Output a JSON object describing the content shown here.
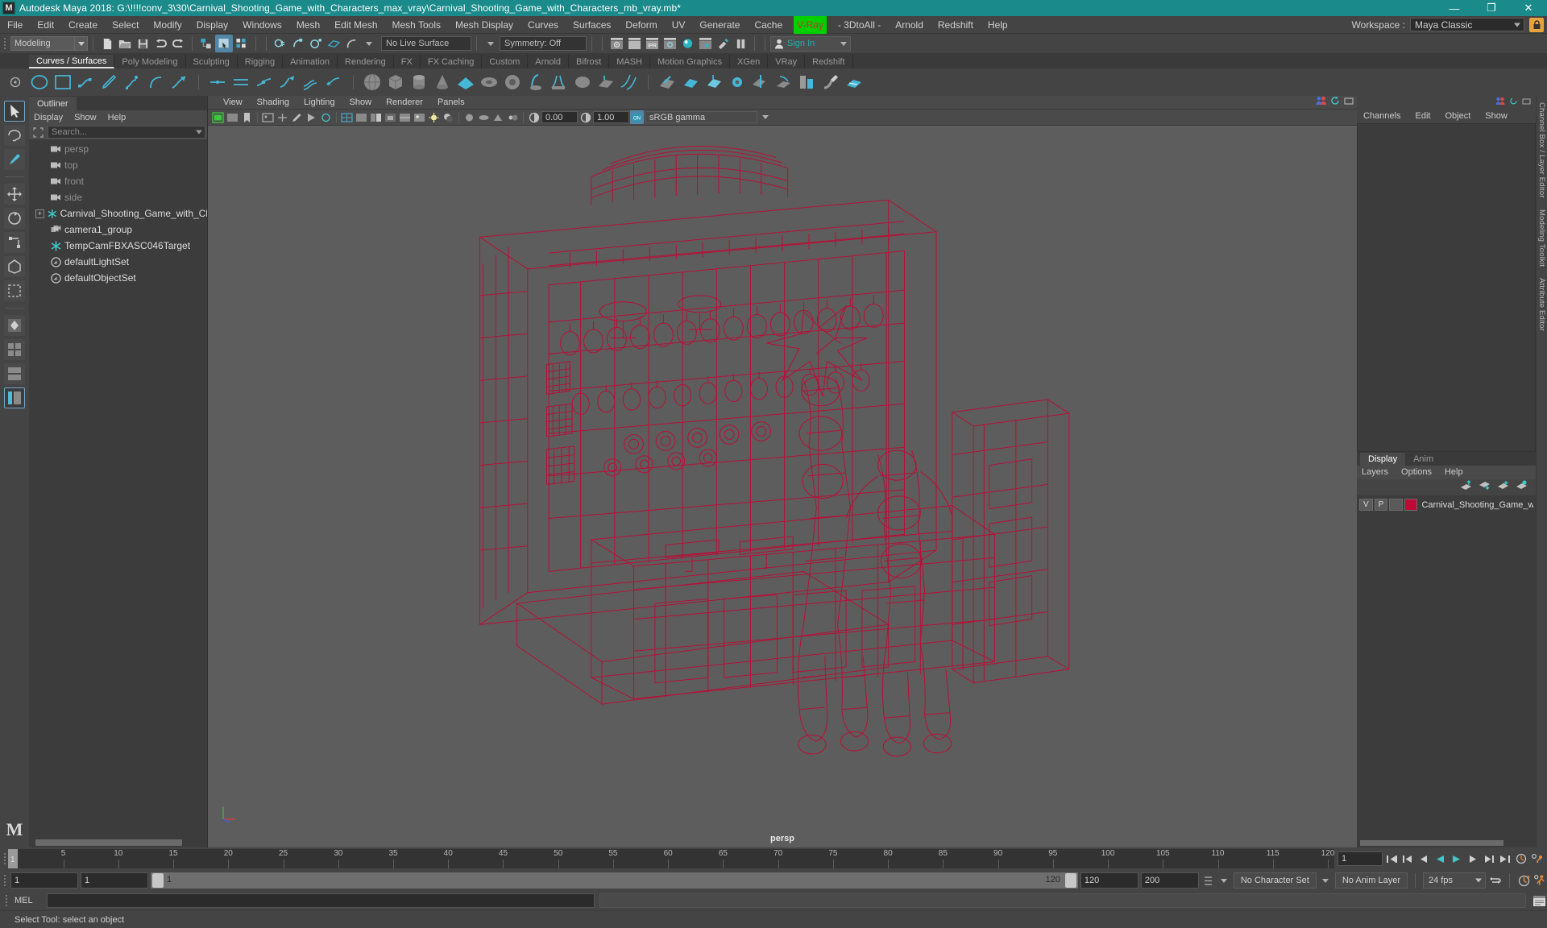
{
  "titlebar": {
    "app_title": "Autodesk Maya 2018: G:\\!!!!conv_3\\30\\Carnival_Shooting_Game_with_Characters_max_vray\\Carnival_Shooting_Game_with_Characters_mb_vray.mb*",
    "logo_text": "M",
    "minimize": "—",
    "maximize": "❐",
    "close": "✕",
    "accent_color": "#1a8a8a"
  },
  "menubar": {
    "items": [
      "File",
      "Edit",
      "Create",
      "Select",
      "Modify",
      "Display",
      "Windows",
      "Mesh",
      "Edit Mesh",
      "Mesh Tools",
      "Mesh Display",
      "Curves",
      "Surfaces",
      "Deform",
      "UV",
      "Generate",
      "Cache"
    ],
    "vray_item": "V-Ray",
    "vray_bg_color": "#00d000",
    "vray_text_color": "#c83232",
    "after_vray": [
      "- 3DtoAll -",
      "Arnold",
      "Redshift",
      "Help"
    ],
    "workspace_label": "Workspace :",
    "workspace_value": "Maya Classic"
  },
  "statusline": {
    "mode_value": "Modeling",
    "live_surface": "No Live Surface",
    "symmetry": "Symmetry: Off",
    "signin": "Sign In",
    "ipr_label": "IPR"
  },
  "shelf": {
    "tabs": [
      {
        "label": "Curves / Surfaces",
        "active": true
      },
      {
        "label": "Poly Modeling",
        "active": false
      },
      {
        "label": "Sculpting",
        "active": false
      },
      {
        "label": "Rigging",
        "active": false
      },
      {
        "label": "Animation",
        "active": false
      },
      {
        "label": "Rendering",
        "active": false
      },
      {
        "label": "FX",
        "active": false
      },
      {
        "label": "FX Caching",
        "active": false
      },
      {
        "label": "Custom",
        "active": false
      },
      {
        "label": "Arnold",
        "active": false
      },
      {
        "label": "Bifrost",
        "active": false
      },
      {
        "label": "MASH",
        "active": false
      },
      {
        "label": "Motion Graphics",
        "active": false
      },
      {
        "label": "XGen",
        "active": false
      },
      {
        "label": "VRay",
        "active": false
      },
      {
        "label": "Redshift",
        "active": false
      }
    ]
  },
  "outliner": {
    "tab_label": "Outliner",
    "menus": [
      "Display",
      "Show",
      "Help"
    ],
    "search_placeholder": "Search...",
    "items": [
      {
        "label": "persp",
        "icon": "camera-icon",
        "dim": true,
        "expandable": false,
        "indent": 1
      },
      {
        "label": "top",
        "icon": "camera-icon",
        "dim": true,
        "expandable": false,
        "indent": 1
      },
      {
        "label": "front",
        "icon": "camera-icon",
        "dim": true,
        "expandable": false,
        "indent": 1
      },
      {
        "label": "side",
        "icon": "camera-icon",
        "dim": true,
        "expandable": false,
        "indent": 1
      },
      {
        "label": "Carnival_Shooting_Game_with_Chara",
        "icon": "transform-icon",
        "dim": false,
        "expandable": true,
        "indent": 0
      },
      {
        "label": "camera1_group",
        "icon": "camera-group-icon",
        "dim": false,
        "expandable": false,
        "indent": 1
      },
      {
        "label": "TempCamFBXASC046Target",
        "icon": "transform-icon",
        "dim": false,
        "expandable": false,
        "indent": 1
      },
      {
        "label": "defaultLightSet",
        "icon": "set-icon",
        "dim": false,
        "expandable": false,
        "indent": 1
      },
      {
        "label": "defaultObjectSet",
        "icon": "set-icon",
        "dim": false,
        "expandable": false,
        "indent": 1
      }
    ]
  },
  "viewport": {
    "menus": [
      "View",
      "Shading",
      "Lighting",
      "Show",
      "Renderer",
      "Panels"
    ],
    "exposure_value": "0.00",
    "gamma_value": "1.00",
    "color_management": "sRGB gamma",
    "camera_label": "persp",
    "background_color": "#5d5d5d",
    "wireframe_color": "#bd0b35",
    "model_name": "Carnival_Shooting_Game_with_Characters"
  },
  "channelbox": {
    "menus": [
      "Channels",
      "Edit",
      "Object",
      "Show"
    ],
    "vertical_tabs": [
      "Channel Box / Layer Editor",
      "Modeling Toolkit",
      "Attribute Editor"
    ]
  },
  "layers": {
    "tabs": [
      {
        "label": "Display",
        "active": true
      },
      {
        "label": "Anim",
        "active": false
      }
    ],
    "menus": [
      "Layers",
      "Options",
      "Help"
    ],
    "rows": [
      {
        "visibility": "V",
        "playback": "P",
        "shading": "",
        "color": "#bd0b35",
        "name": "Carnival_Shooting_Game_with"
      }
    ]
  },
  "timeslider": {
    "current_frame": "1",
    "ticks": [
      5,
      10,
      15,
      20,
      25,
      30,
      35,
      40,
      45,
      50,
      55,
      60,
      65,
      70,
      75,
      80,
      85,
      90,
      95,
      100,
      105,
      110,
      115,
      120
    ],
    "range_min": 1,
    "range_max": 120,
    "field_frame": "1"
  },
  "rangeslider": {
    "start_field": "1",
    "start_field2": "1",
    "bar_start_label": "1",
    "bar_end_label": "120",
    "end_field": "120",
    "end_field2": "200",
    "character_set": "No Character Set",
    "anim_layer": "No Anim Layer",
    "fps": "24 fps"
  },
  "commandline": {
    "mel_label": "MEL",
    "input_value": "",
    "output_value": ""
  },
  "helpline": {
    "text": "Select Tool: select an object"
  }
}
